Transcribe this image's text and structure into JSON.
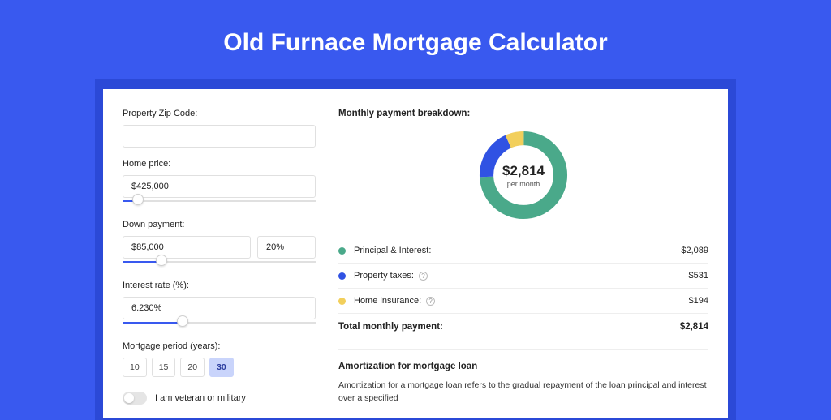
{
  "title": "Old Furnace Mortgage Calculator",
  "form": {
    "zip_label": "Property Zip Code:",
    "zip_value": "",
    "price_label": "Home price:",
    "price_value": "$425,000",
    "price_pct": 8,
    "dp_label": "Down payment:",
    "dp_value": "$85,000",
    "dp_pct_value": "20%",
    "dp_pct": 20,
    "rate_label": "Interest rate (%):",
    "rate_value": "6.230%",
    "rate_pct": 31,
    "period_label": "Mortgage period (years):",
    "periods": [
      "10",
      "15",
      "20",
      "30"
    ],
    "period_active": "30",
    "vet_label": "I am veteran or military"
  },
  "breakdown": {
    "title": "Monthly payment breakdown:",
    "donut_amount": "$2,814",
    "donut_sub": "per month",
    "pi_label": "Principal & Interest:",
    "pi_value": "$2,089",
    "tax_label": "Property taxes:",
    "tax_value": "$531",
    "ins_label": "Home insurance:",
    "ins_value": "$194",
    "total_label": "Total monthly payment:",
    "total_value": "$2,814"
  },
  "amort": {
    "title": "Amortization for mortgage loan",
    "text": "Amortization for a mortgage loan refers to the gradual repayment of the loan principal and interest over a specified"
  },
  "colors": {
    "pi": "#4aa98a",
    "tax": "#3052e3",
    "ins": "#f2cf5b"
  },
  "chart_data": {
    "type": "pie",
    "title": "Monthly payment breakdown",
    "series": [
      {
        "name": "Principal & Interest",
        "value": 2089,
        "color": "#4aa98a"
      },
      {
        "name": "Property taxes",
        "value": 531,
        "color": "#3052e3"
      },
      {
        "name": "Home insurance",
        "value": 194,
        "color": "#f2cf5b"
      }
    ],
    "total": 2814,
    "unit": "USD per month"
  }
}
